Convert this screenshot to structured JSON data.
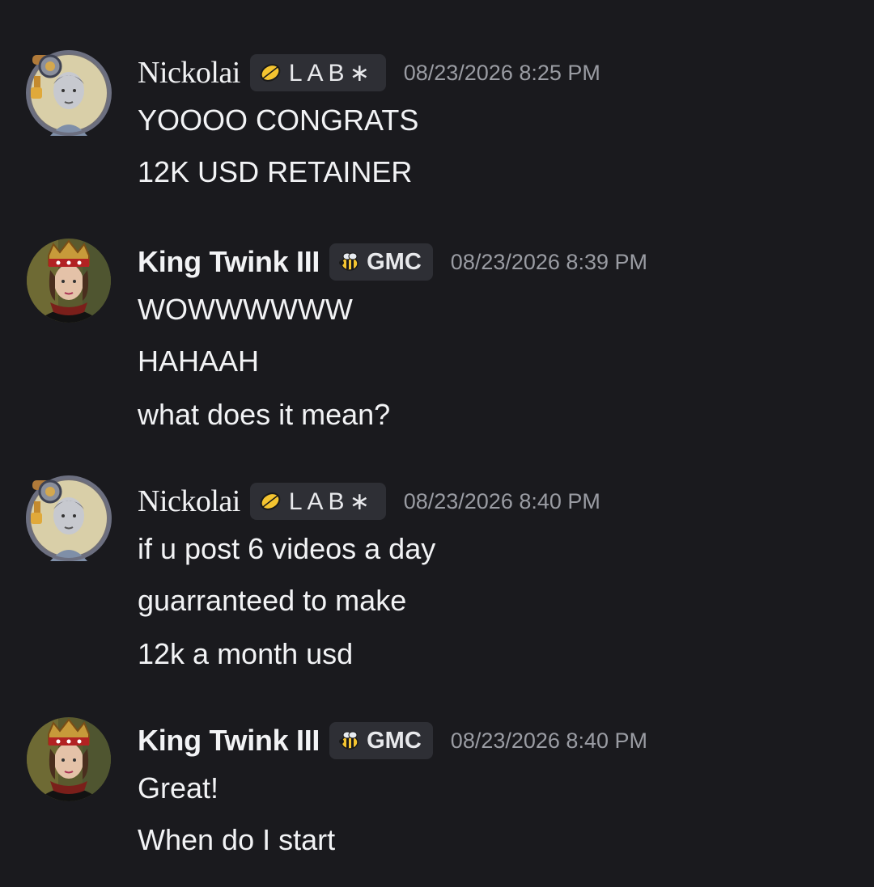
{
  "messages": [
    {
      "author": "Nickolai",
      "tag_icon": "lemon-icon",
      "tag": "LAB∗",
      "timestamp": "08/23/2026 8:25 PM",
      "lines": [
        "YOOOO CONGRATS",
        "12K USD RETAINER"
      ]
    },
    {
      "author": "King Twink III",
      "tag_icon": "bee-icon",
      "tag": "GMC",
      "timestamp": "08/23/2026 8:39 PM",
      "lines": [
        "WOWWWWWW",
        "HAHAAH",
        "what does it mean?"
      ]
    },
    {
      "author": "Nickolai",
      "tag_icon": "lemon-icon",
      "tag": "LAB∗",
      "timestamp": "08/23/2026 8:40 PM",
      "lines": [
        "if u post 6 videos a day",
        "guarranteed to make",
        "12k a month usd"
      ]
    },
    {
      "author": "King Twink III",
      "tag_icon": "bee-icon",
      "tag": "GMC",
      "timestamp": "08/23/2026 8:40 PM",
      "lines": [
        "Great!",
        "When do I start"
      ]
    }
  ],
  "colors": {
    "background": "#1a1a1e",
    "text": "#f2f3f5",
    "timestamp": "#9a9ca3",
    "tag_background": "#2e2f35"
  }
}
